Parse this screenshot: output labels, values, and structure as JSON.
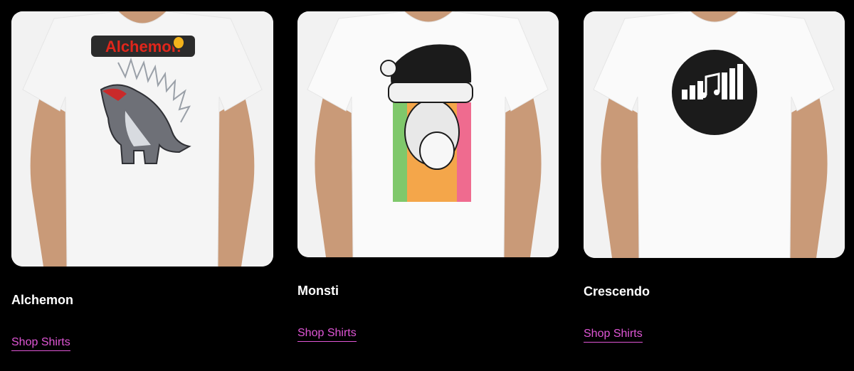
{
  "products": [
    {
      "name": "Alchemon",
      "link_label": "Shop Shirts",
      "design_text": "Alchemon",
      "design": "monster-graphic"
    },
    {
      "name": "Monsti",
      "link_label": "Shop Shirts",
      "design": "monster-santa-hat-graphic"
    },
    {
      "name": "Crescendo",
      "link_label": "Shop Shirts",
      "design": "music-bars-circle-logo"
    }
  ],
  "colors": {
    "background": "#000000",
    "title": "#ffffff",
    "link": "#e056d6",
    "shirt": "#ffffff"
  }
}
